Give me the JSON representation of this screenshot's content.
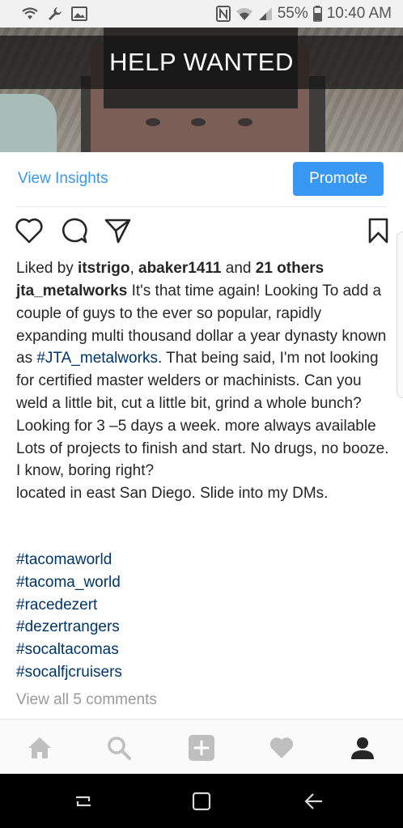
{
  "status_bar": {
    "battery": "55%",
    "time": "10:40 AM",
    "left_icons": [
      "wifi-calling-icon",
      "wrench-icon",
      "image-icon"
    ],
    "right_icons": [
      "nfc-icon",
      "wifi-icon",
      "signal-icon",
      "battery-icon"
    ]
  },
  "post": {
    "image_banner": "HELP WANTED",
    "view_insights_label": "View Insights",
    "promote_label": "Promote",
    "likes": {
      "prefix": "Liked by ",
      "user1": "itstrigo",
      "sep": ", ",
      "user2": "abaker1411",
      "and": " and ",
      "others": "21 others"
    },
    "caption": {
      "username": "jta_metalworks",
      "text_part1": " It's that time again! Looking To add a couple of guys to the ever so popular, rapidly expanding multi thousand dollar a year dynasty known as ",
      "hashtag_inline": "#JTA_metalworks",
      "text_part2": ". That being said, I'm not looking for certified master welders or machinists. Can you weld a little bit, cut a little bit, grind a whole bunch? Looking for 3 –5 days a week. more always available Lots of projects to finish and start. No drugs, no booze. I know, boring right?",
      "line_location": "located in east San Diego. Slide into my DMs."
    },
    "hashtags": [
      "#tacomaworld",
      "#tacoma_world",
      "#racedezert",
      "#dezertrangers",
      "#socaltacomas",
      "#socalfjcruisers"
    ],
    "view_comments_label": "View all 5 comments"
  },
  "action_icons": [
    "heart-icon",
    "comment-icon",
    "share-icon",
    "bookmark-icon"
  ],
  "tab_bar": [
    "home-icon",
    "search-icon",
    "add-post-icon",
    "activity-heart-icon",
    "profile-icon"
  ],
  "nav_bar": [
    "recents-icon",
    "home-square-icon",
    "back-icon"
  ],
  "colors": {
    "link_blue": "#3897f0",
    "hashtag_navy": "#003569",
    "muted_gray": "#999999",
    "text": "#262626"
  }
}
